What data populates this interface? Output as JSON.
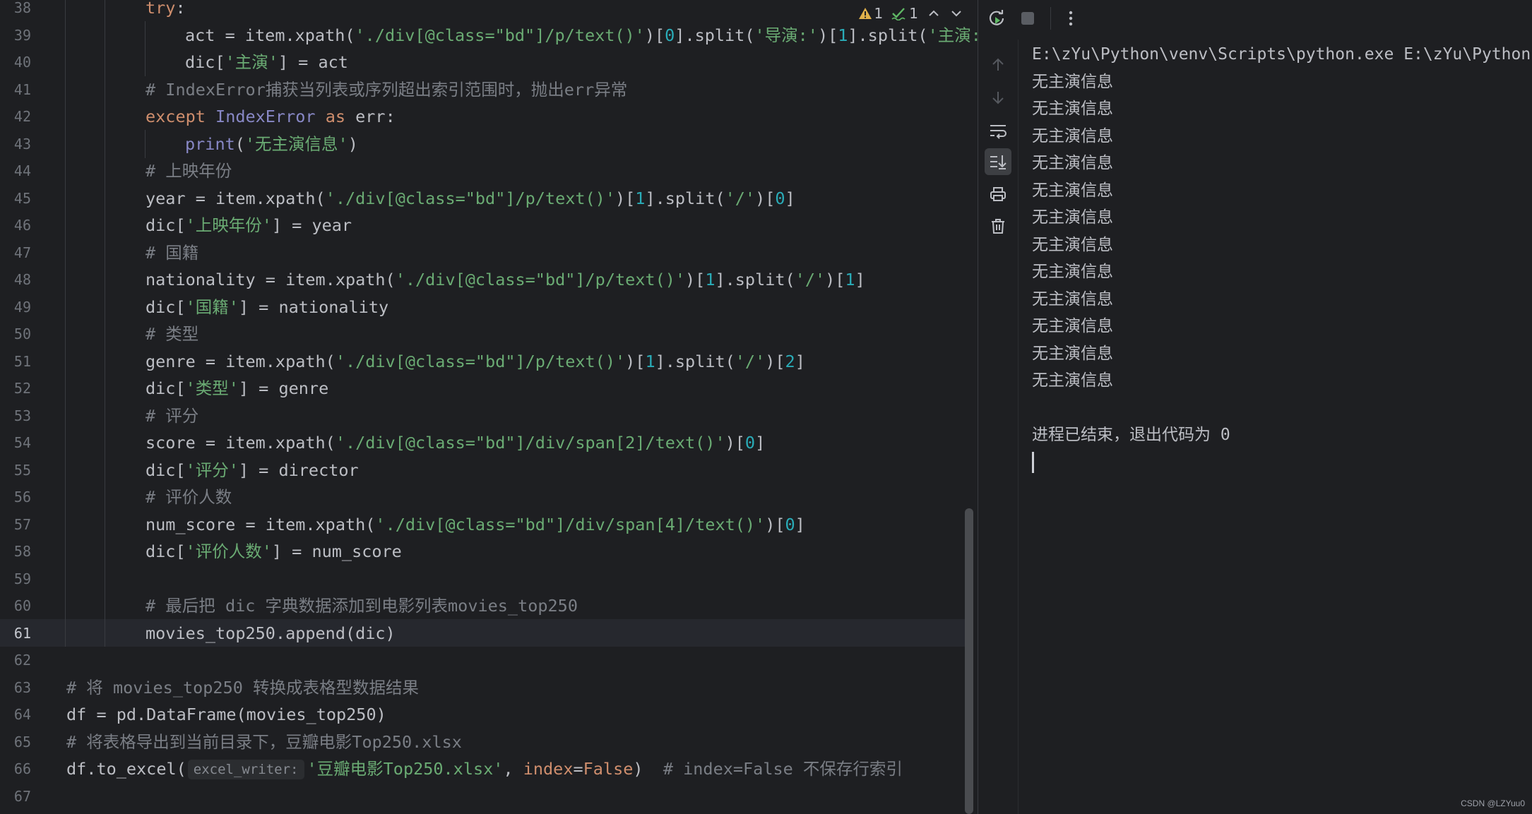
{
  "editor": {
    "inspection": {
      "warnings": "1",
      "typos": "1"
    },
    "current_line": "61",
    "lines": [
      {
        "n": "38"
      },
      {
        "n": "39"
      },
      {
        "n": "40"
      },
      {
        "n": "41"
      },
      {
        "n": "42"
      },
      {
        "n": "43"
      },
      {
        "n": "44"
      },
      {
        "n": "45"
      },
      {
        "n": "46"
      },
      {
        "n": "47"
      },
      {
        "n": "48"
      },
      {
        "n": "49"
      },
      {
        "n": "50"
      },
      {
        "n": "51"
      },
      {
        "n": "52"
      },
      {
        "n": "53"
      },
      {
        "n": "54"
      },
      {
        "n": "55"
      },
      {
        "n": "56"
      },
      {
        "n": "57"
      },
      {
        "n": "58"
      },
      {
        "n": "59"
      },
      {
        "n": "60"
      },
      {
        "n": "61"
      },
      {
        "n": "62"
      },
      {
        "n": "63"
      },
      {
        "n": "64"
      },
      {
        "n": "65"
      },
      {
        "n": "66"
      },
      {
        "n": "67"
      }
    ],
    "code": {
      "l38_try": "try",
      "l38_colon": ":",
      "l39_a": "act = item.xpath(",
      "l39_s1": "'./div[@class=\"bd\"]/p/text()'",
      "l39_b": ")[",
      "l39_n0": "0",
      "l39_c": "].split(",
      "l39_s2": "'导演:'",
      "l39_d": ")[",
      "l39_n1": "1",
      "l39_e": "].split(",
      "l39_s3": "'主演:'",
      "l40_a": "dic[",
      "l40_s": "'主演'",
      "l40_b": "] = act",
      "l41_cm": "# IndexError捕获当列表或序列超出索引范围时，抛出err异常",
      "l42_except": "except",
      "l42_cls": "IndexError",
      "l42_as": "as",
      "l42_rest": "err:",
      "l43_print": "print",
      "l43_a": "(",
      "l43_s": "'无主演信息'",
      "l43_b": ")",
      "l44_cm": "# 上映年份",
      "l45_a": "year = item.xpath(",
      "l45_s1": "'./div[@class=\"bd\"]/p/text()'",
      "l45_b": ")[",
      "l45_n1": "1",
      "l45_c": "].split(",
      "l45_s2": "'/'",
      "l45_d": ")[",
      "l45_n2": "0",
      "l45_e": "]",
      "l46_a": "dic[",
      "l46_s": "'上映年份'",
      "l46_b": "] = year",
      "l47_cm": "# 国籍",
      "l48_a": "nationality = item.xpath(",
      "l48_s1": "'./div[@class=\"bd\"]/p/text()'",
      "l48_b": ")[",
      "l48_n1": "1",
      "l48_c": "].split(",
      "l48_s2": "'/'",
      "l48_d": ")[",
      "l48_n2": "1",
      "l48_e": "]",
      "l49_a": "dic[",
      "l49_s": "'国籍'",
      "l49_b": "] = nationality",
      "l50_cm": "# 类型",
      "l51_a": "genre = item.xpath(",
      "l51_s1": "'./div[@class=\"bd\"]/p/text()'",
      "l51_b": ")[",
      "l51_n1": "1",
      "l51_c": "].split(",
      "l51_s2": "'/'",
      "l51_d": ")[",
      "l51_n2": "2",
      "l51_e": "]",
      "l52_a": "dic[",
      "l52_s": "'类型'",
      "l52_b": "] = genre",
      "l53_cm": "# 评分",
      "l54_a": "score = item.xpath(",
      "l54_s1": "'./div[@class=\"bd\"]/div/span[2]/text()'",
      "l54_b": ")[",
      "l54_n": "0",
      "l54_c": "]",
      "l55_a": "dic[",
      "l55_s": "'评分'",
      "l55_b": "] = director",
      "l56_cm": "# 评价人数",
      "l57_a": "num_score = item.xpath(",
      "l57_s1": "'./div[@class=\"bd\"]/div/span[4]/text()'",
      "l57_b": ")[",
      "l57_n": "0",
      "l57_c": "]",
      "l58_a": "dic[",
      "l58_s": "'评价人数'",
      "l58_b": "] = num_score",
      "l60_cm": "# 最后把 dic 字典数据添加到电影列表movies_top250",
      "l61": "movies_top250.append(dic)",
      "l63_cm": "# 将 movies_top250 转换成表格型数据结果",
      "l64": "df = pd.DataFrame(movies_top250)",
      "l65_cm": "# 将表格导出到当前目录下，豆瓣电影Top250.xlsx",
      "l66_a": "df.to_excel(",
      "l66_hint": "excel_writer:",
      "l66_s": "'豆瓣电影Top250.xlsx'",
      "l66_b": ", ",
      "l66_param": "index",
      "l66_c": "=",
      "l66_false": "False",
      "l66_d": ")  ",
      "l66_cm": "# index=False 不保存行索引"
    }
  },
  "run": {
    "command": "E:\\zYu\\Python\\venv\\Scripts\\python.exe E:\\zYu\\Python",
    "output": [
      "无主演信息",
      "无主演信息",
      "无主演信息",
      "无主演信息",
      "无主演信息",
      "无主演信息",
      "无主演信息",
      "无主演信息",
      "无主演信息",
      "无主演信息",
      "无主演信息",
      "无主演信息"
    ],
    "exit_message": "进程已结束，退出代码为 0"
  },
  "watermark": "CSDN @LZYuu0",
  "colors": {
    "bg": "#1e1f22",
    "keyword": "#cf8e6d",
    "string": "#6aab73",
    "number": "#2aacb8",
    "comment": "#7a7e85",
    "function": "#56a8f5"
  }
}
